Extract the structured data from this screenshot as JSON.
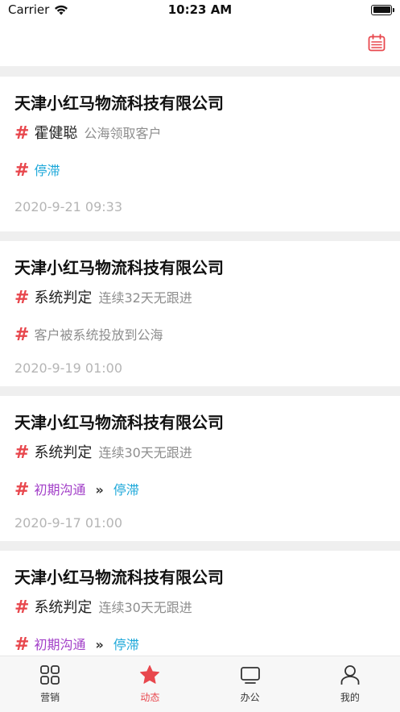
{
  "status_bar": {
    "carrier": "Carrier",
    "time": "10:23 AM"
  },
  "header": {
    "calendar_icon": "calendar-icon"
  },
  "feed": [
    {
      "company": "天津小红马物流科技有限公司",
      "actor": "霍健聪",
      "action": "公海领取客户",
      "status_line": {
        "type": "single",
        "text": "停滞",
        "color": "#1ba7d9"
      },
      "time": "2020-9-21 09:33"
    },
    {
      "company": "天津小红马物流科技有限公司",
      "actor": "系统判定",
      "action": "连续32天无跟进",
      "status_line": {
        "type": "single",
        "text": "客户被系统投放到公海",
        "color": "#8e8e8e"
      },
      "time": "2020-9-19 01:00"
    },
    {
      "company": "天津小红马物流科技有限公司",
      "actor": "系统判定",
      "action": "连续30天无跟进",
      "status_line": {
        "type": "transition",
        "from": "初期沟通",
        "arrow": "»",
        "to": "停滞"
      },
      "time": "2020-9-17 01:00"
    },
    {
      "company": "天津小红马物流科技有限公司",
      "actor": "系统判定",
      "action": "连续30天无跟进",
      "status_line": {
        "type": "transition",
        "from": "初期沟通",
        "arrow": "»",
        "to": "停滞"
      },
      "time": ""
    }
  ],
  "tabbar": {
    "tabs": [
      {
        "label": "营销",
        "icon": "grid-icon",
        "active": false
      },
      {
        "label": "动态",
        "icon": "star-icon",
        "active": true
      },
      {
        "label": "办公",
        "icon": "monitor-icon",
        "active": false
      },
      {
        "label": "我的",
        "icon": "user-icon",
        "active": false
      }
    ]
  },
  "colors": {
    "accent": "#e8474d",
    "blue": "#1ba7d9",
    "purple": "#a23fc8"
  }
}
